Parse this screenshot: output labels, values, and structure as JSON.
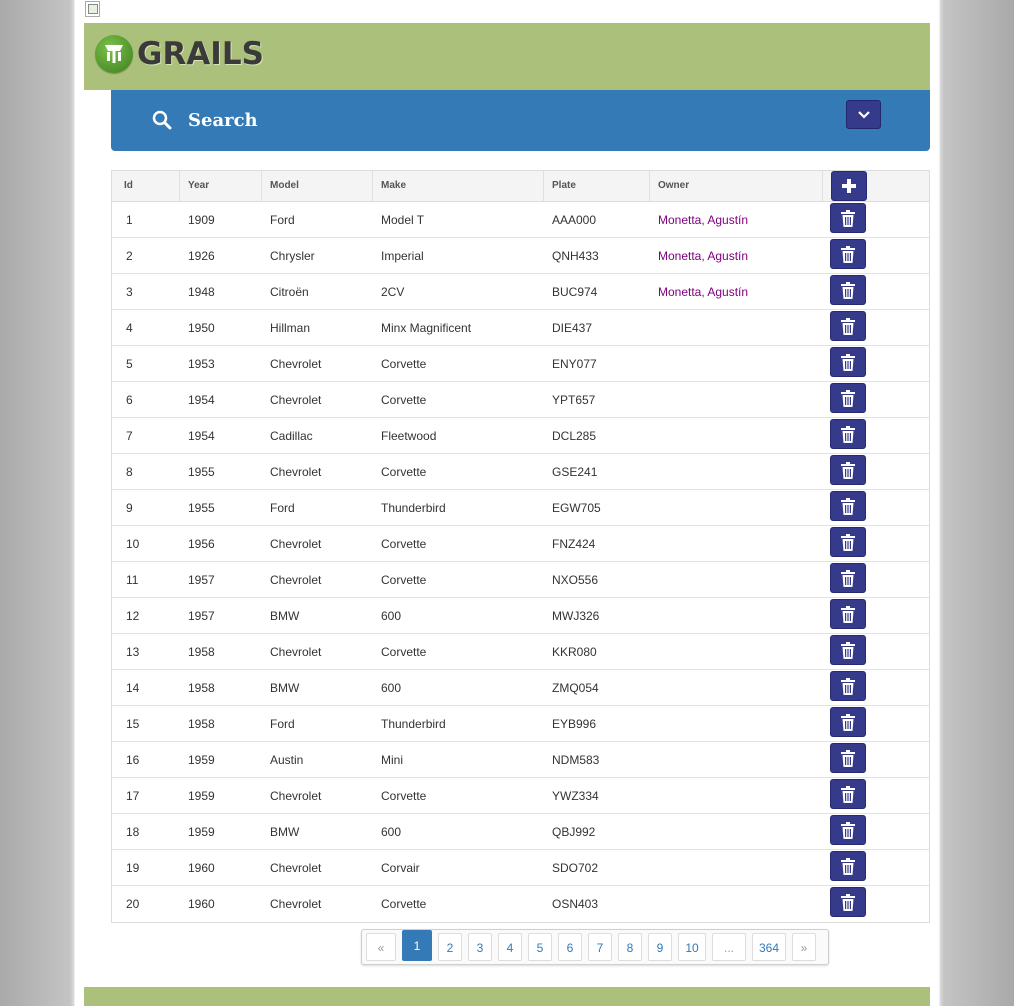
{
  "app": {
    "logo_text": "GRAILS"
  },
  "search": {
    "label": "Search"
  },
  "table": {
    "columns": [
      "Id",
      "Year",
      "Model",
      "Make",
      "Plate",
      "Owner"
    ],
    "rows": [
      {
        "id": "1",
        "year": "1909",
        "model": "Ford",
        "make": "Model T",
        "plate": "AAA000",
        "owner": "Monetta, Agustín"
      },
      {
        "id": "2",
        "year": "1926",
        "model": "Chrysler",
        "make": "Imperial",
        "plate": "QNH433",
        "owner": "Monetta, Agustín"
      },
      {
        "id": "3",
        "year": "1948",
        "model": "Citroën",
        "make": "2CV",
        "plate": "BUC974",
        "owner": "Monetta, Agustín"
      },
      {
        "id": "4",
        "year": "1950",
        "model": "Hillman",
        "make": "Minx Magnificent",
        "plate": "DIE437",
        "owner": ""
      },
      {
        "id": "5",
        "year": "1953",
        "model": "Chevrolet",
        "make": "Corvette",
        "plate": "ENY077",
        "owner": ""
      },
      {
        "id": "6",
        "year": "1954",
        "model": "Chevrolet",
        "make": "Corvette",
        "plate": "YPT657",
        "owner": ""
      },
      {
        "id": "7",
        "year": "1954",
        "model": "Cadillac",
        "make": "Fleetwood",
        "plate": "DCL285",
        "owner": ""
      },
      {
        "id": "8",
        "year": "1955",
        "model": "Chevrolet",
        "make": "Corvette",
        "plate": "GSE241",
        "owner": ""
      },
      {
        "id": "9",
        "year": "1955",
        "model": "Ford",
        "make": "Thunderbird",
        "plate": "EGW705",
        "owner": ""
      },
      {
        "id": "10",
        "year": "1956",
        "model": "Chevrolet",
        "make": "Corvette",
        "plate": "FNZ424",
        "owner": ""
      },
      {
        "id": "11",
        "year": "1957",
        "model": "Chevrolet",
        "make": "Corvette",
        "plate": "NXO556",
        "owner": ""
      },
      {
        "id": "12",
        "year": "1957",
        "model": "BMW",
        "make": "600",
        "plate": "MWJ326",
        "owner": ""
      },
      {
        "id": "13",
        "year": "1958",
        "model": "Chevrolet",
        "make": "Corvette",
        "plate": "KKR080",
        "owner": ""
      },
      {
        "id": "14",
        "year": "1958",
        "model": "BMW",
        "make": "600",
        "plate": "ZMQ054",
        "owner": ""
      },
      {
        "id": "15",
        "year": "1958",
        "model": "Ford",
        "make": "Thunderbird",
        "plate": "EYB996",
        "owner": ""
      },
      {
        "id": "16",
        "year": "1959",
        "model": "Austin",
        "make": "Mini",
        "plate": "NDM583",
        "owner": ""
      },
      {
        "id": "17",
        "year": "1959",
        "model": "Chevrolet",
        "make": "Corvette",
        "plate": "YWZ334",
        "owner": ""
      },
      {
        "id": "18",
        "year": "1959",
        "model": "BMW",
        "make": "600",
        "plate": "QBJ992",
        "owner": ""
      },
      {
        "id": "19",
        "year": "1960",
        "model": "Chevrolet",
        "make": "Corvair",
        "plate": "SDO702",
        "owner": ""
      },
      {
        "id": "20",
        "year": "1960",
        "model": "Chevrolet",
        "make": "Corvette",
        "plate": "OSN403",
        "owner": ""
      }
    ]
  },
  "pagination": {
    "items": [
      "«",
      "1",
      "2",
      "3",
      "4",
      "5",
      "6",
      "7",
      "8",
      "9",
      "10",
      "...",
      "364",
      "»"
    ],
    "active": "1"
  },
  "icons": {
    "search": "search-icon",
    "toggle": "chevron-down-icon",
    "add": "plus-icon",
    "delete": "trash-icon"
  },
  "colors": {
    "header_green": "#abc07a",
    "search_blue": "#337ab7",
    "button_navy": "#353a8a",
    "owner_link": "#800080"
  }
}
